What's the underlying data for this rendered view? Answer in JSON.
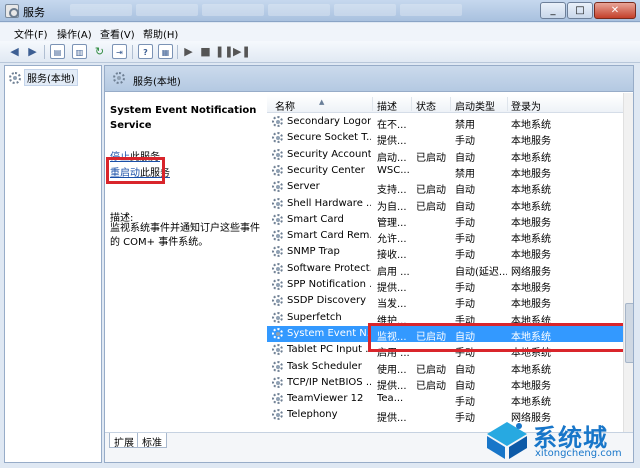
{
  "window": {
    "title": "服务"
  },
  "menu": [
    "文件(F)",
    "操作(A)",
    "查看(V)",
    "帮助(H)"
  ],
  "tree": {
    "root": "服务(本地)"
  },
  "main": {
    "header": "服务(本地)",
    "service_name": "System Event Notification Service",
    "stop_link": "停止",
    "stop_rest": "此服务",
    "restart_link": "重启动",
    "restart_rest": "此服务",
    "desc_label": "描述:",
    "desc_text": "监视系统事件并通知订户这些事件的 COM+ 事件系统。"
  },
  "columns": {
    "name": "名称",
    "desc": "描述",
    "status": "状态",
    "startup": "启动类型",
    "logon": "登录为"
  },
  "rows": [
    {
      "name": "Secondary Logon",
      "desc": "在不...",
      "status": "",
      "startup": "禁用",
      "logon": "本地系统"
    },
    {
      "name": "Secure Socket T...",
      "desc": "提供...",
      "status": "",
      "startup": "手动",
      "logon": "本地服务"
    },
    {
      "name": "Security Account...",
      "desc": "启动...",
      "status": "已启动",
      "startup": "自动",
      "logon": "本地系统"
    },
    {
      "name": "Security Center",
      "desc": "WSC...",
      "status": "",
      "startup": "禁用",
      "logon": "本地服务"
    },
    {
      "name": "Server",
      "desc": "支持...",
      "status": "已启动",
      "startup": "自动",
      "logon": "本地系统"
    },
    {
      "name": "Shell Hardware ...",
      "desc": "为自...",
      "status": "已启动",
      "startup": "自动",
      "logon": "本地系统"
    },
    {
      "name": "Smart Card",
      "desc": "管理...",
      "status": "",
      "startup": "手动",
      "logon": "本地服务"
    },
    {
      "name": "Smart Card Rem...",
      "desc": "允许...",
      "status": "",
      "startup": "手动",
      "logon": "本地系统"
    },
    {
      "name": "SNMP Trap",
      "desc": "接收...",
      "status": "",
      "startup": "手动",
      "logon": "本地服务"
    },
    {
      "name": "Software Protect...",
      "desc": "启用 ...",
      "status": "",
      "startup": "自动(延迟...",
      "logon": "网络服务"
    },
    {
      "name": "SPP Notification ...",
      "desc": "提供...",
      "status": "",
      "startup": "手动",
      "logon": "本地服务"
    },
    {
      "name": "SSDP Discovery",
      "desc": "当发...",
      "status": "",
      "startup": "手动",
      "logon": "本地服务"
    },
    {
      "name": "Superfetch",
      "desc": "维护...",
      "status": "",
      "startup": "手动",
      "logon": "本地系统"
    },
    {
      "name": "System Event N...",
      "desc": "监视...",
      "status": "已启动",
      "startup": "自动",
      "logon": "本地系统"
    },
    {
      "name": "Tablet PC Input ...",
      "desc": "启用 ...",
      "status": "",
      "startup": "手动",
      "logon": "本地系统"
    },
    {
      "name": "Task Scheduler",
      "desc": "使用...",
      "status": "已启动",
      "startup": "自动",
      "logon": "本地系统"
    },
    {
      "name": "TCP/IP NetBIOS ...",
      "desc": "提供...",
      "status": "已启动",
      "startup": "自动",
      "logon": "本地服务"
    },
    {
      "name": "TeamViewer 12",
      "desc": "Tea...",
      "status": "",
      "startup": "手动",
      "logon": "本地系统"
    },
    {
      "name": "Telephony",
      "desc": "提供...",
      "status": "",
      "startup": "手动",
      "logon": "网络服务"
    }
  ],
  "tabs": [
    "扩展",
    "标准"
  ],
  "watermark": {
    "brand": "系统城",
    "url": "xitongcheng.com"
  },
  "colors": {
    "selection": "#3399ff",
    "highlight_box": "#d9252b",
    "brand": "#1876c9"
  }
}
